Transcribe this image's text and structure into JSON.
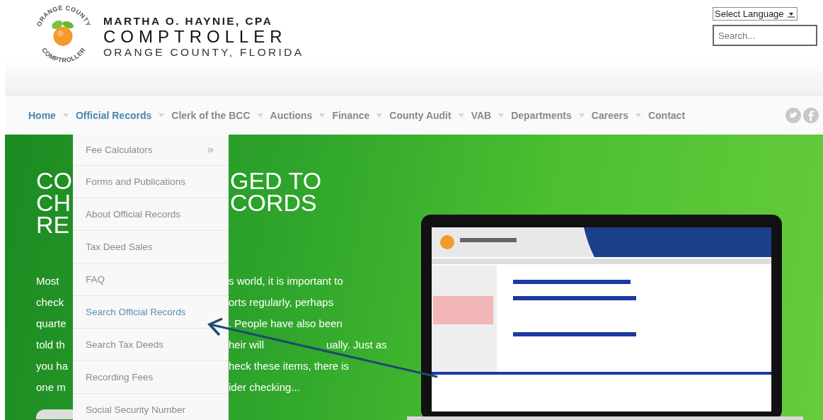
{
  "header": {
    "logo_text_top": "ORANGE COUNTY",
    "logo_text_bottom": "COMPTROLLER",
    "name": "MARTHA O. HAYNIE, CPA",
    "title": "COMPTROLLER",
    "subtitle": "ORANGE COUNTY, FLORIDA",
    "language_select": "Select Language",
    "search": {
      "placeholder": "Search..."
    }
  },
  "nav": [
    {
      "label": "Home",
      "highlighted": true
    },
    {
      "label": "Official Records",
      "highlighted": true
    },
    {
      "label": "Clerk of the BCC",
      "highlighted": false
    },
    {
      "label": "Auctions",
      "highlighted": false
    },
    {
      "label": "Finance",
      "highlighted": false
    },
    {
      "label": "County Audit",
      "highlighted": false
    },
    {
      "label": "VAB",
      "highlighted": false
    },
    {
      "label": "Departments",
      "highlighted": false
    },
    {
      "label": "Careers",
      "highlighted": false
    },
    {
      "label": "Contact",
      "highlighted": false
    }
  ],
  "dropdown": [
    {
      "label": "Fee Calculators",
      "has_submenu": true,
      "selected": false
    },
    {
      "label": "Forms and Publications",
      "has_submenu": false,
      "selected": false
    },
    {
      "label": "About Official Records",
      "has_submenu": false,
      "selected": false
    },
    {
      "label": "Tax Deed Sales",
      "has_submenu": false,
      "selected": false
    },
    {
      "label": "FAQ",
      "has_submenu": false,
      "selected": false
    },
    {
      "label": "Search Official Records",
      "has_submenu": false,
      "selected": true
    },
    {
      "label": "Search Tax Deeds",
      "has_submenu": false,
      "selected": false
    },
    {
      "label": "Recording Fees",
      "has_submenu": false,
      "selected": false
    },
    {
      "label": "Social Security Number",
      "has_submenu": false,
      "selected": false
    }
  ],
  "hero": {
    "title_left": [
      "CO",
      "CH",
      "RE"
    ],
    "title_right": [
      "GED TO",
      "CORDS"
    ],
    "text_left": [
      "Most",
      "check",
      "quarte",
      "told th",
      "you ha",
      "one m"
    ],
    "text_right": [
      [
        "s world, it is important to"
      ],
      [
        "orts regularly, perhaps"
      ],
      [
        ". People have also been"
      ],
      [
        "heir will",
        "ually. Just as"
      ],
      [
        "heck these items, there is"
      ],
      [
        "ider checking..."
      ]
    ]
  }
}
